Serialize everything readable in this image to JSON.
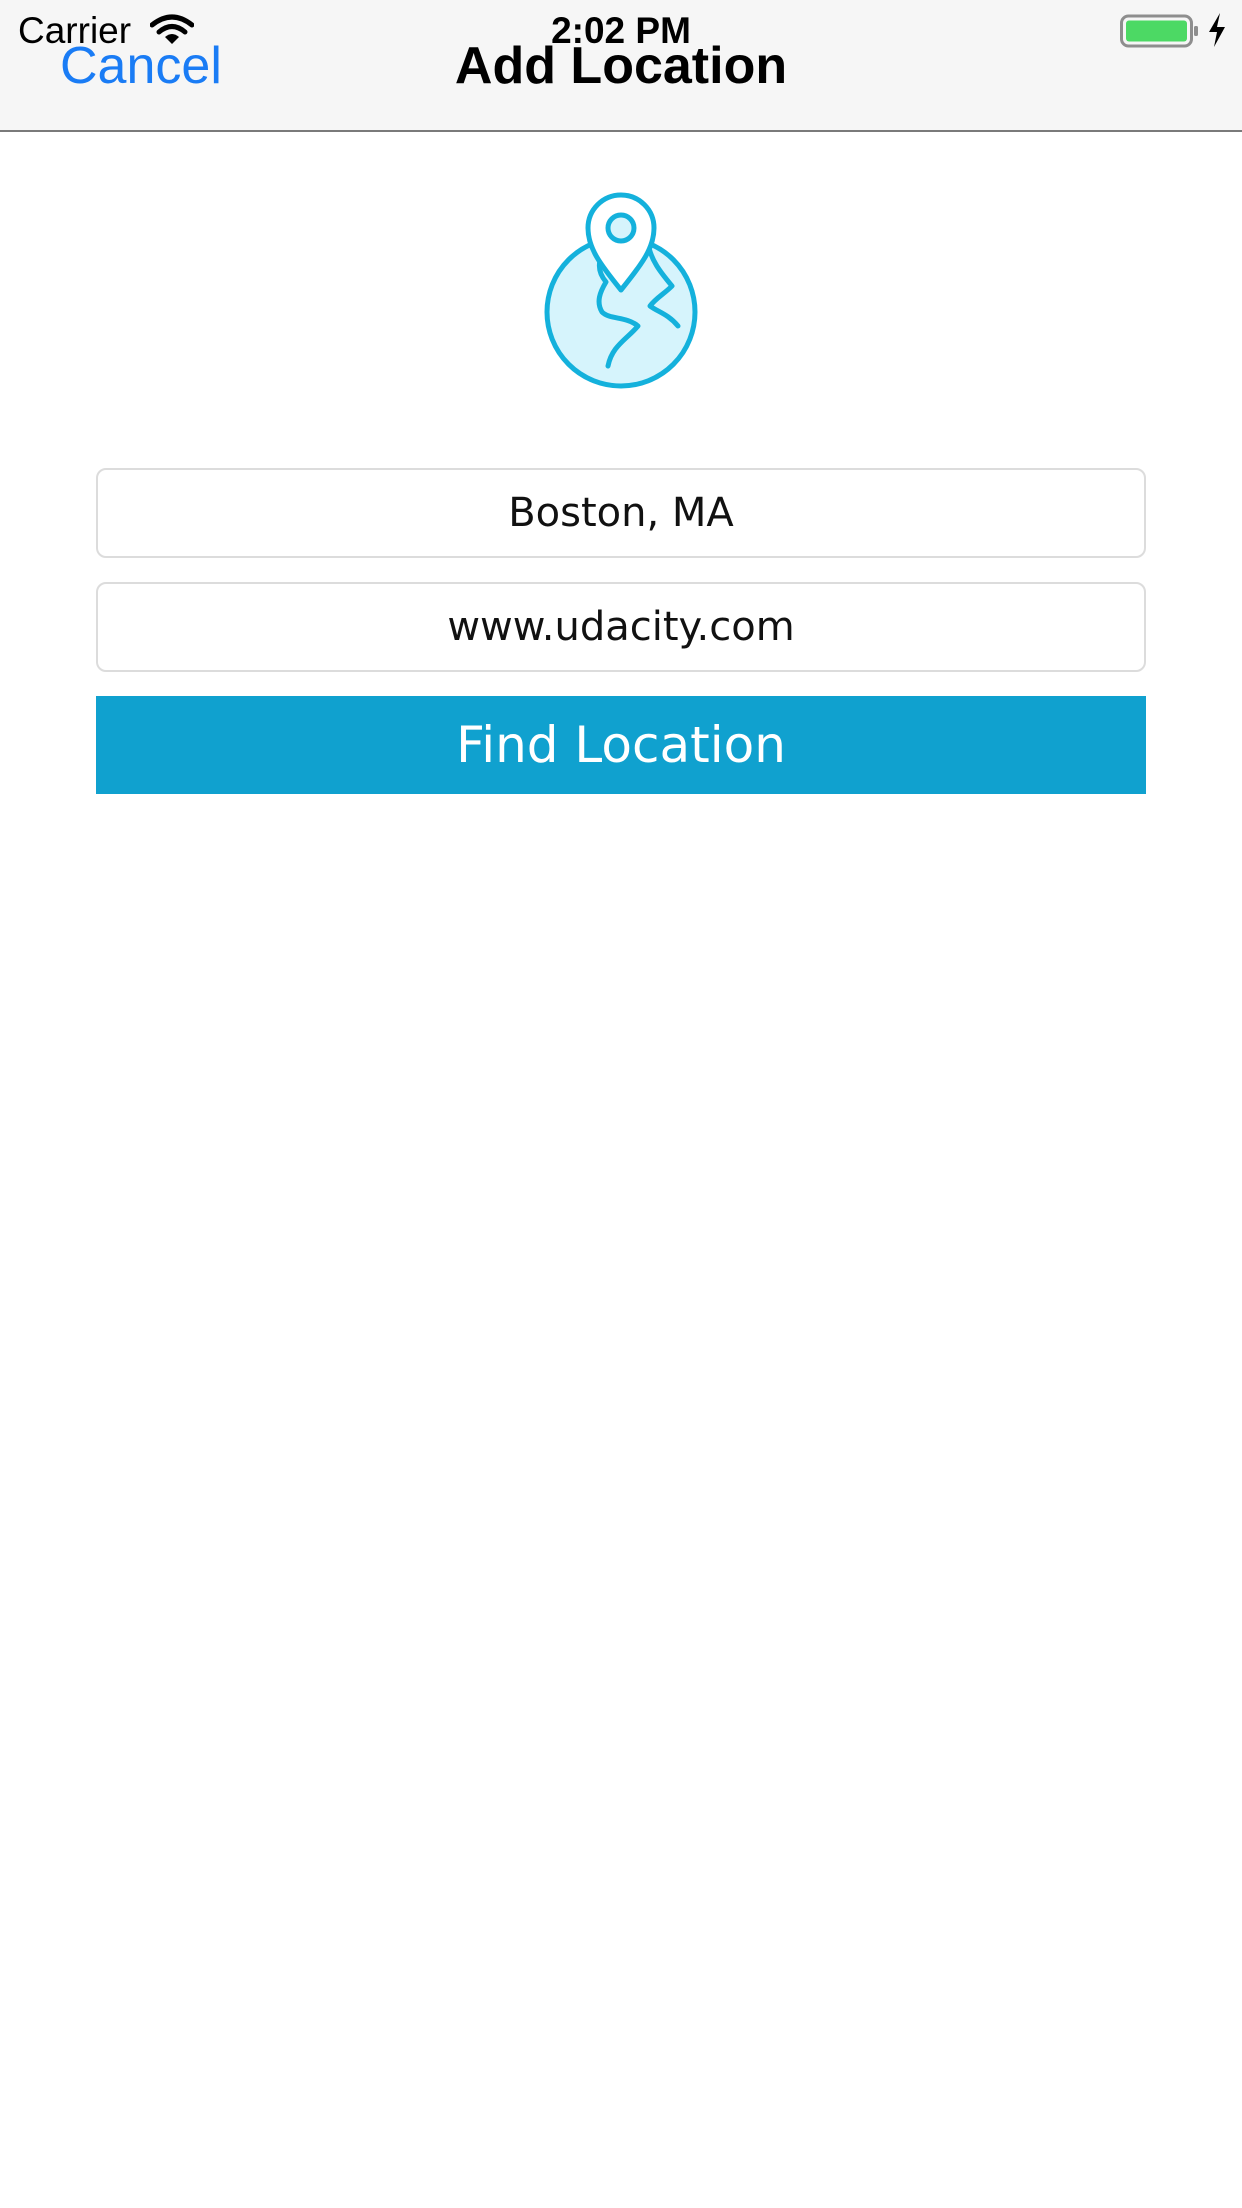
{
  "status_bar": {
    "carrier": "Carrier",
    "time": "2:02 PM",
    "icons": [
      "wifi-icon",
      "battery-icon",
      "charging-icon"
    ]
  },
  "nav": {
    "cancel_label": "Cancel",
    "title": "Add Location"
  },
  "header_icon": "globe-location-pin-icon",
  "form": {
    "location_value": "Boston, MA",
    "website_value": "www.udacity.com",
    "find_button_label": "Find Location"
  },
  "colors": {
    "accent": "#10a1cf",
    "nav_link": "#1a7cf5",
    "globe_stroke": "#14b1dc",
    "globe_fill": "#d6f4fc",
    "battery": "#4cd964"
  }
}
